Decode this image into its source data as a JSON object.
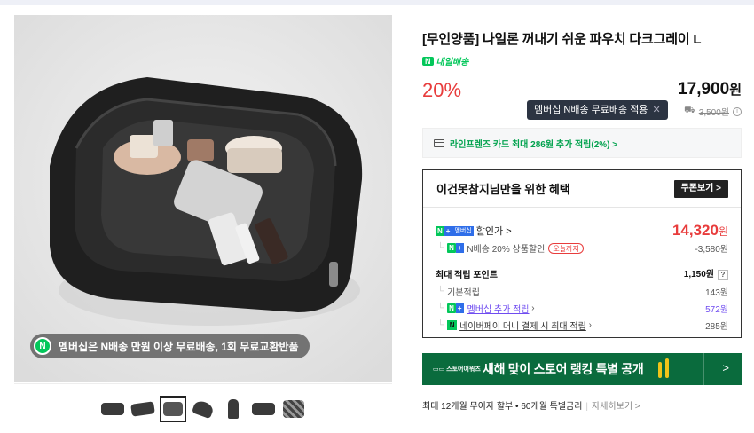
{
  "product": {
    "title": "[무인양품] 나일론 꺼내기 쉬운 파우치 다크그레이 L",
    "delivery_tag": "내일배송",
    "delivery_logo": "N",
    "discount": "20%",
    "price": "17,900",
    "currency": "원",
    "tooltip": "멤버십 N배송 무료배송 적용",
    "tooltip_close": "✕",
    "orig_price_icon": "truck-icon",
    "orig_price": "3,500원"
  },
  "gallery": {
    "promo_text": "멤버십은 N배송 만원 이상 무료배송, 1회 무료교환반품",
    "promo_badge": "N",
    "thumbnails": [
      "pouch-front",
      "pouch-side",
      "pouch-open",
      "pouch-angle",
      "bottle",
      "pouch-closed",
      "pouch-pattern"
    ],
    "selected_thumbnail": 2
  },
  "card_offer": {
    "text": "라인프렌즈 카드 최대 286원 추가 적립(2%) >"
  },
  "benefits": {
    "title": "이건못참지님만을 위한 혜택",
    "coupon_button": "쿠폰보기 >",
    "discount_label": "할인가 >",
    "member_tag": "멤버십",
    "sale_price": "14,320",
    "currency": "원",
    "npay_discount_label": "N배송 20% 상품할인",
    "today_only": "오늘까지",
    "npay_discount_value": "-3,580원",
    "points_label": "최대 적립 포인트",
    "points_value": "1,150원",
    "points_help": "?",
    "base_points_label": "기본적립",
    "base_points_value": "143원",
    "member_points_label": "멤버십 추가 적립",
    "member_points_value": "572원",
    "pay_points_label": "네이버페이 머니 결제 시 최대 적립",
    "pay_points_value": "285원",
    "pay_badge": "N"
  },
  "banner": {
    "brand": "▭▭ 스토어어워즈",
    "text": "새해 맞이 스토어 랭킹 특별 공개",
    "arrow": ">"
  },
  "installment": {
    "text": "최대 12개월 무이자 할부 • 60개월 특별금리",
    "more": "자세히보기 >"
  }
}
